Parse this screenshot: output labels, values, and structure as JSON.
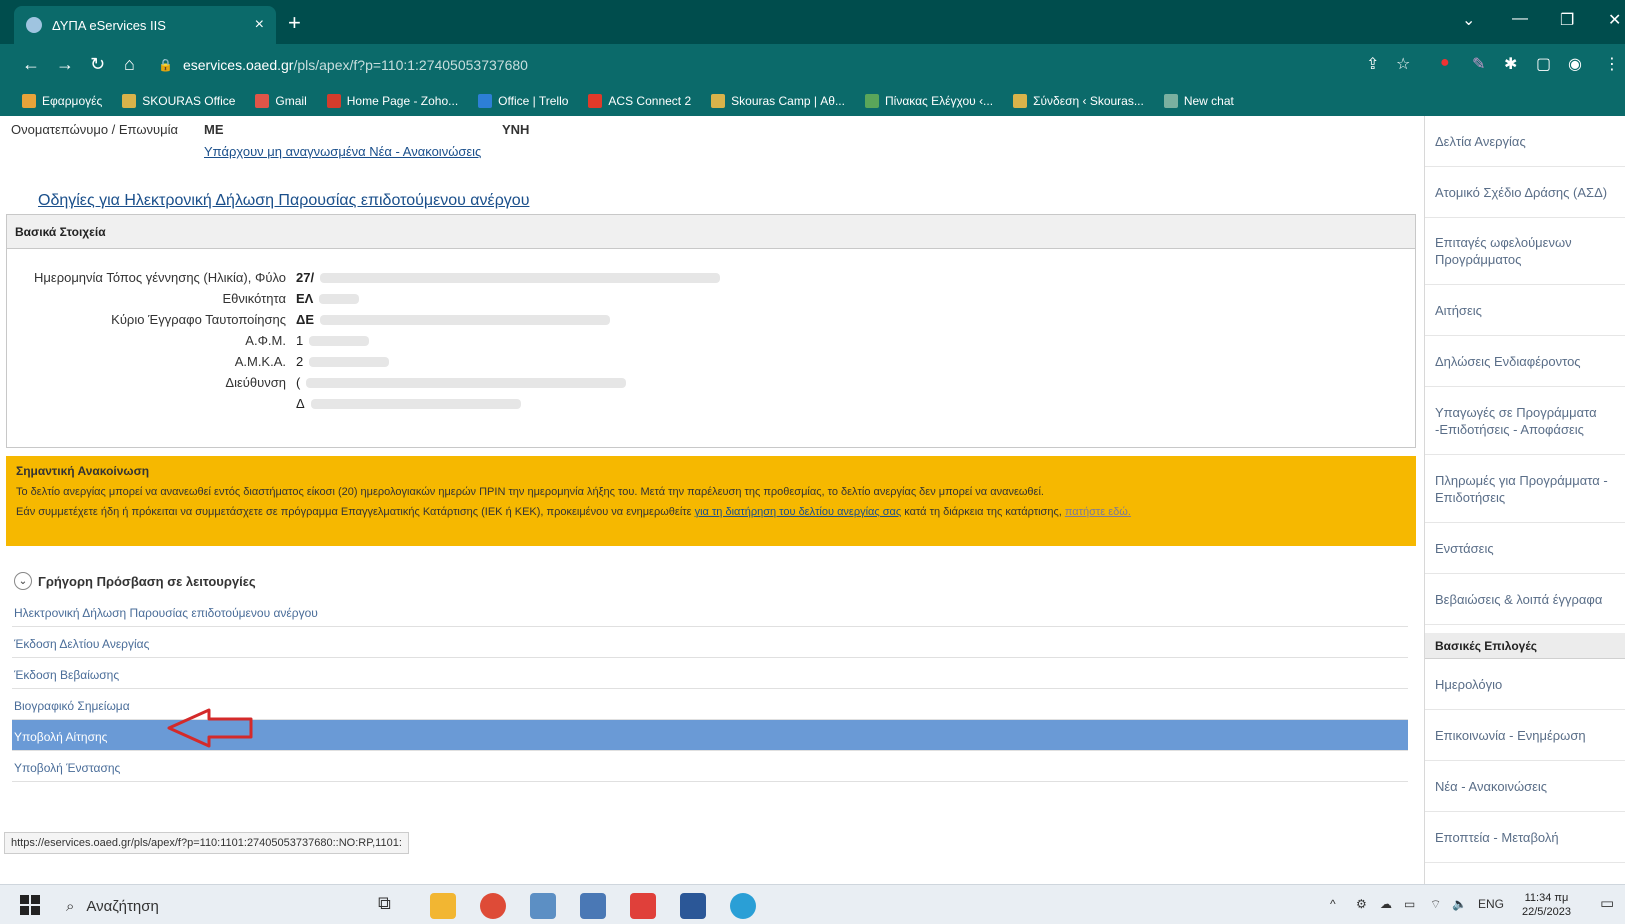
{
  "browser": {
    "tab_title": "ΔΥΠΑ eServices IIS",
    "url_host": "eservices.oaed.gr",
    "url_path": "/pls/apex/f?p=110:1:27405053737680",
    "bookmarks": [
      {
        "label": "Εφαρμογές",
        "color": "#e8a33a"
      },
      {
        "label": "SKOURAS Office",
        "color": "#d9b34a"
      },
      {
        "label": "Gmail",
        "color": "#e05548"
      },
      {
        "label": "Home Page - Zoho...",
        "color": "#d33c2c"
      },
      {
        "label": "Office | Trello",
        "color": "#2d7fd6"
      },
      {
        "label": "ACS Connect 2",
        "color": "#e03a2a"
      },
      {
        "label": "Skouras Camp | Αθ...",
        "color": "#d9b34a"
      },
      {
        "label": "Πίνακας Ελέγχου ‹...",
        "color": "#5aa65a"
      },
      {
        "label": "Σύνδεση ‹ Skouras...",
        "color": "#d9b34a"
      },
      {
        "label": "New chat",
        "color": "#7ab0a0"
      }
    ]
  },
  "header": {
    "name_label": "Ονοματεπώνυμο / Επωνυμία",
    "name_value_start": "ΜΕ",
    "name_value_end": "ΥΝΗ",
    "unread_link": "Υπάρχουν μη αναγνωσμένα Νέα - Ανακοινώσεις",
    "instructions_link": "Οδηγίες για Ηλεκτρονική Δήλωση Παρουσίας επιδοτούμενου ανέργου"
  },
  "basic": {
    "title": "Βασικά Στοιχεία",
    "rows": [
      {
        "label": "Ημερομηνία Τόπος γέννησης (Ηλικία), Φύλο",
        "value": "27/"
      },
      {
        "label": "Εθνικότητα",
        "value": "ΕΛ"
      },
      {
        "label": "Κύριο Έγγραφο Ταυτοποίησης",
        "value": "ΔΕ"
      },
      {
        "label": "Α.Φ.Μ.",
        "value": "1"
      },
      {
        "label": "Α.Μ.Κ.Α.",
        "value": "2"
      },
      {
        "label": "Διεύθυνση",
        "value": "("
      },
      {
        "label": "",
        "value": "Δ"
      }
    ]
  },
  "notice": {
    "title": "Σημαντική Ανακοίνωση",
    "line1": "Το δελτίο ανεργίας μπορεί να ανανεωθεί εντός διαστήματος είκοσι (20) ημερολογιακών ημερών ΠΡΙΝ την ημερομηνία λήξης του. Μετά την παρέλευση της προθεσμίας, το δελτίο ανεργίας δεν μπορεί να ανανεωθεί.",
    "line2_start": "Εάν συμμετέχετε ήδη ή πρόκειται να συμμετάσχετε σε πρόγραμμα Επαγγελματικής Κατάρτισης (ΙΕΚ ή ΚΕΚ), προκειμένου να ενημερωθείτε",
    "line2_link": "για τη διατήρηση του δελτίου ανεργίας σας",
    "line2_mid": "κατά τη διάρκεια της κατάρτισης,",
    "line2_link2": "πατήστε εδώ."
  },
  "quick_access": {
    "title": "Γρήγορη Πρόσβαση σε λειτουργίες",
    "items": [
      "Ηλεκτρονική Δήλωση Παρουσίας επιδοτούμενου ανέργου",
      "Έκδοση Δελτίου Ανεργίας",
      "Έκδοση Βεβαίωσης",
      "Βιογραφικό Σημείωμα",
      "Υποβολή Αίτησης",
      "Υποβολή Ένστασης"
    ],
    "active_index": 4
  },
  "status_url": "https://eservices.oaed.gr/pls/apex/f?p=110:1101:27405053737680::NO:RP,1101:",
  "sidebar": {
    "items_top": [
      "Δελτία Ανεργίας",
      "Ατομικό Σχέδιο Δράσης (ΑΣΔ)",
      "Επιταγές ωφελούμενων Προγράμματος",
      "Αιτήσεις",
      "Δηλώσεις Ενδιαφέροντος",
      "Υπαγωγές σε Προγράμματα -Επιδοτήσεις - Αποφάσεις",
      "Πληρωμές για Προγράμματα - Επιδοτήσεις",
      "Ενστάσεις",
      "Βεβαιώσεις & λοιπά έγγραφα"
    ],
    "section_title": "Βασικές Επιλογές",
    "items_bottom": [
      "Ημερολόγιο",
      "Επικοινωνία - Ενημέρωση",
      "Νέα - Ανακοινώσεις",
      "Εποπτεία - Μεταβολή"
    ]
  },
  "taskbar": {
    "search_placeholder": "Αναζήτηση",
    "lang": "ENG",
    "time": "11:34 πμ",
    "date": "22/5/2023"
  },
  "colors": {
    "chrome": "#0b6a6a",
    "notice": "#f6b800",
    "active_row": "#6a9ad6",
    "arrow": "#d42a2a"
  }
}
